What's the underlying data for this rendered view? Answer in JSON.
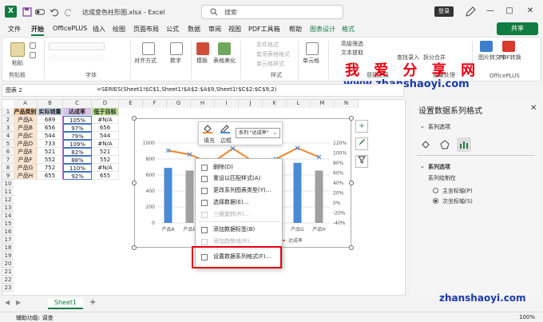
{
  "titlebar": {
    "app_logo": "X",
    "document_title": "达成变色柱形图.xlsx - Excel",
    "search_placeholder": "搜索",
    "login_label": "登录",
    "minimize_glyph": "—",
    "maximize_glyph": "□",
    "close_glyph": "✕"
  },
  "tabs": [
    "文件",
    "开始",
    "OfficePLUS",
    "插入",
    "绘图",
    "页面布局",
    "公式",
    "数据",
    "审阅",
    "视图",
    "PDF工具箱",
    "帮助",
    "图表设计",
    "格式"
  ],
  "share_label": "共享",
  "ribbon": {
    "paste_label": "粘贴",
    "clipboard_group": "剪贴板",
    "font_group": "字体",
    "align_label": "对齐方式",
    "number_label": "数字",
    "template_label": "模板",
    "table_beautify_label": "表格美化",
    "cond_format_label": "条件格式",
    "table_format_label": "套用表格格式",
    "cell_style_label": "单元格样式",
    "styles_group": "样式",
    "cells_label": "单元格",
    "adv_filter_label": "高级筛选",
    "text_tools_label": "文本提取",
    "quick_tools_group": "便捷工具",
    "vlookup_label": "查找录入",
    "split_merge_label": "拆分合并",
    "batch_group": "批量处理",
    "picture_to_text_label": "图片转文字",
    "pdf_convert_label": "PDF转换",
    "officeplus_group": "OfficePLUS"
  },
  "watermark_cn": "我 爱 分 享 网",
  "watermark_url": "www.zhanshaoyi.com",
  "watermark_url2": "zhanshaoyi.com",
  "formulabar": {
    "name_box": "图表 2",
    "formula": "=SERIES(Sheet1!$C$1,Sheet1!$A$2:$A$9,Sheet1!$C$2:$C$9,2)"
  },
  "columns": [
    "A",
    "B",
    "C",
    "D",
    "E",
    "F",
    "G",
    "H",
    "I",
    "J",
    "K",
    "L",
    "M",
    "N"
  ],
  "table": {
    "headers": [
      "产品类别",
      "实际销量",
      "达成率",
      "低于目标"
    ],
    "rows": [
      [
        "产品A",
        "689",
        "105%",
        "#N/A"
      ],
      [
        "产品B",
        "656",
        "97%",
        "656"
      ],
      [
        "产品C",
        "544",
        "79%",
        "544"
      ],
      [
        "产品D",
        "733",
        "109%",
        "#N/A"
      ],
      [
        "产品E",
        "521",
        "82%",
        "521"
      ],
      [
        "产品F",
        "552",
        "88%",
        "552"
      ],
      [
        "产品G",
        "752",
        "110%",
        "#N/A"
      ],
      [
        "产品H",
        "655",
        "92%",
        "655"
      ]
    ]
  },
  "chart_data": {
    "type": "bar",
    "categories": [
      "产品A",
      "产品B",
      "产品C",
      "产品D",
      "产品E",
      "产品F",
      "产品G",
      "产品H"
    ],
    "series": [
      {
        "name": "实际销量",
        "values": [
          689,
          656,
          544,
          733,
          521,
          552,
          752,
          655
        ],
        "axis": "primary"
      },
      {
        "name": "达成率",
        "type": "line",
        "values": [
          1.05,
          0.97,
          0.79,
          1.09,
          0.82,
          0.88,
          1.1,
          0.92
        ],
        "axis": "secondary"
      }
    ],
    "y_ticks": [
      "1000",
      "800",
      "600",
      "400",
      "200",
      "0"
    ],
    "y2_ticks": [
      "120%",
      "100%",
      "80%",
      "60%",
      "40%",
      "20%",
      "0%",
      "-20%",
      "-40%"
    ],
    "ylim": [
      0,
      1000
    ],
    "y2lim": [
      -0.4,
      1.2
    ],
    "legend_visible": "达成率",
    "bar_color": "#4a8bd6",
    "bar_below_color": "#a0a0a0",
    "line_color": "#f0852d"
  },
  "float_toolbar": {
    "fill_label": "填充",
    "border_label": "边框",
    "series_select": "系列 \"达成率\""
  },
  "context_menu": {
    "items": [
      {
        "label": "删除(D)",
        "disabled": false
      },
      {
        "label": "重设以匹配样式(A)",
        "disabled": false
      },
      {
        "label": "更改系列图表类型(Y)...",
        "disabled": false
      },
      {
        "label": "选择数据(E)...",
        "disabled": false
      },
      {
        "label": "三维旋转(R)...",
        "disabled": true
      },
      {
        "label": "添加数据标签(B)",
        "disabled": false
      },
      {
        "label": "添加趋势线(R)...",
        "disabled": true
      },
      {
        "label": "设置数据系列格式(F)...",
        "disabled": false
      }
    ]
  },
  "pane": {
    "title": "设置数据系列格式",
    "dropdown": "系列选项",
    "section": "系列选项",
    "plot_on": "系列绘制在",
    "primary_axis": "主坐标轴(P)",
    "secondary_axis": "次坐标轴(S)"
  },
  "sheet": {
    "tab_name": "Sheet1",
    "add_glyph": "+"
  },
  "status": {
    "accessibility": "辅助功能: 调查",
    "zoom": "100%"
  }
}
